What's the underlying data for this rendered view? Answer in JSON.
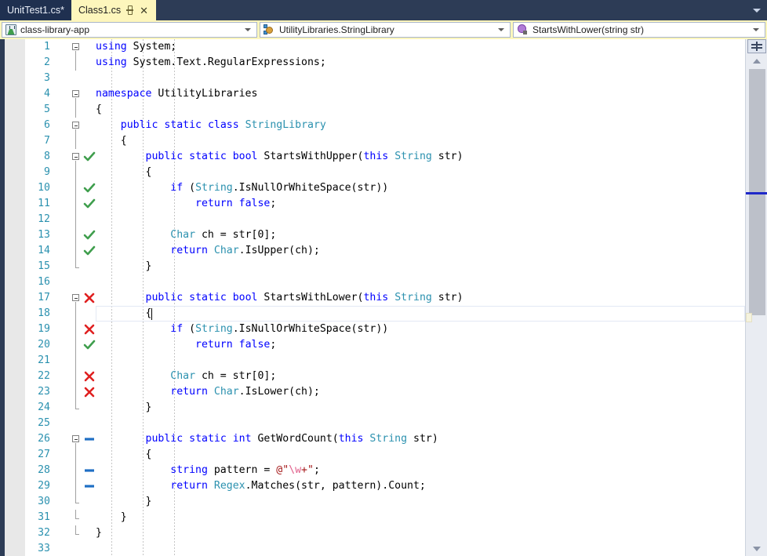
{
  "tabs": [
    {
      "name": "UnitTest1.cs*",
      "active": false,
      "dirty": true
    },
    {
      "name": "Class1.cs",
      "active": true,
      "dirty": false,
      "pin_icon": "pin-icon",
      "close_icon": "close-icon"
    }
  ],
  "tabstrip": {
    "overflow_icon": "chevron-down-icon"
  },
  "navbar": {
    "project": {
      "label": "class-library-app",
      "icon": "test-project-flask-icon",
      "arrow_icon": "chevron-down-icon"
    },
    "type": {
      "label": "UtilityLibraries.StringLibrary",
      "icon": "class-icon",
      "arrow_icon": "chevron-down-icon"
    },
    "member": {
      "label": "StartsWithLower(string str)",
      "icon": "method-icon",
      "arrow_icon": "chevron-down-icon"
    }
  },
  "editor": {
    "language": "csharp",
    "cursor_line": 18,
    "cursor_column": 10,
    "colors": {
      "keyword": "#0000ff",
      "type": "#2b91af",
      "string": "#a31515",
      "plain": "#000000",
      "line_number": "#2b91af",
      "covered": "#3f9e4d",
      "not_covered": "#e02020",
      "partially_covered": "#1f6fc4",
      "tab_active_bg": "#fdf6bc",
      "tab_inactive_bg": "#1f3050",
      "chrome_bg": "#2d3c56"
    },
    "glyph_legend": {
      "check": "code-coverage-covered-icon",
      "cross": "code-coverage-not-covered-icon",
      "dash": "code-coverage-not-run-icon"
    },
    "lines": [
      {
        "n": 1,
        "fold": "start",
        "cov": "none",
        "indent": 0,
        "tokens": [
          {
            "t": "using",
            "c": "kw"
          },
          {
            "t": " System;",
            "c": "pln"
          }
        ]
      },
      {
        "n": 2,
        "fold": "mid",
        "cov": "none",
        "indent": 0,
        "tokens": [
          {
            "t": "using",
            "c": "kw"
          },
          {
            "t": " System.Text.RegularExpressions;",
            "c": "pln"
          }
        ]
      },
      {
        "n": 3,
        "fold": "none",
        "cov": "none",
        "indent": 0,
        "tokens": []
      },
      {
        "n": 4,
        "fold": "start",
        "cov": "none",
        "indent": 0,
        "tokens": [
          {
            "t": "namespace",
            "c": "kw"
          },
          {
            "t": " UtilityLibraries",
            "c": "pln"
          }
        ]
      },
      {
        "n": 5,
        "fold": "mid",
        "cov": "none",
        "indent": 0,
        "tokens": [
          {
            "t": "{",
            "c": "pln"
          }
        ]
      },
      {
        "n": 6,
        "fold": "start",
        "cov": "none",
        "indent": 1,
        "tokens": [
          {
            "t": "    ",
            "c": "pln"
          },
          {
            "t": "public",
            "c": "kw"
          },
          {
            "t": " ",
            "c": "pln"
          },
          {
            "t": "static",
            "c": "kw"
          },
          {
            "t": " ",
            "c": "pln"
          },
          {
            "t": "class",
            "c": "kw"
          },
          {
            "t": " ",
            "c": "pln"
          },
          {
            "t": "StringLibrary",
            "c": "typ"
          }
        ]
      },
      {
        "n": 7,
        "fold": "mid",
        "cov": "none",
        "indent": 1,
        "tokens": [
          {
            "t": "    {",
            "c": "pln"
          }
        ]
      },
      {
        "n": 8,
        "fold": "start",
        "cov": "check",
        "indent": 2,
        "tokens": [
          {
            "t": "        ",
            "c": "pln"
          },
          {
            "t": "public",
            "c": "kw"
          },
          {
            "t": " ",
            "c": "pln"
          },
          {
            "t": "static",
            "c": "kw"
          },
          {
            "t": " ",
            "c": "pln"
          },
          {
            "t": "bool",
            "c": "kw"
          },
          {
            "t": " StartsWithUpper(",
            "c": "pln"
          },
          {
            "t": "this",
            "c": "kw"
          },
          {
            "t": " ",
            "c": "pln"
          },
          {
            "t": "String",
            "c": "typ"
          },
          {
            "t": " str)",
            "c": "pln"
          }
        ]
      },
      {
        "n": 9,
        "fold": "mid",
        "cov": "none",
        "indent": 2,
        "tokens": [
          {
            "t": "        {",
            "c": "pln"
          }
        ]
      },
      {
        "n": 10,
        "fold": "mid",
        "cov": "check",
        "indent": 3,
        "tokens": [
          {
            "t": "            ",
            "c": "pln"
          },
          {
            "t": "if",
            "c": "kw"
          },
          {
            "t": " (",
            "c": "pln"
          },
          {
            "t": "String",
            "c": "typ"
          },
          {
            "t": ".IsNullOrWhiteSpace(str))",
            "c": "pln"
          }
        ]
      },
      {
        "n": 11,
        "fold": "mid",
        "cov": "check",
        "indent": 4,
        "tokens": [
          {
            "t": "                ",
            "c": "pln"
          },
          {
            "t": "return",
            "c": "kw"
          },
          {
            "t": " ",
            "c": "pln"
          },
          {
            "t": "false",
            "c": "kw"
          },
          {
            "t": ";",
            "c": "pln"
          }
        ]
      },
      {
        "n": 12,
        "fold": "mid",
        "cov": "none",
        "indent": 3,
        "tokens": []
      },
      {
        "n": 13,
        "fold": "mid",
        "cov": "check",
        "indent": 3,
        "tokens": [
          {
            "t": "            ",
            "c": "pln"
          },
          {
            "t": "Char",
            "c": "typ"
          },
          {
            "t": " ch = str[",
            "c": "pln"
          },
          {
            "t": "0",
            "c": "pln"
          },
          {
            "t": "];",
            "c": "pln"
          }
        ]
      },
      {
        "n": 14,
        "fold": "mid",
        "cov": "check",
        "indent": 3,
        "tokens": [
          {
            "t": "            ",
            "c": "pln"
          },
          {
            "t": "return",
            "c": "kw"
          },
          {
            "t": " ",
            "c": "pln"
          },
          {
            "t": "Char",
            "c": "typ"
          },
          {
            "t": ".IsUpper(ch);",
            "c": "pln"
          }
        ]
      },
      {
        "n": 15,
        "fold": "end",
        "cov": "none",
        "indent": 2,
        "tokens": [
          {
            "t": "        }",
            "c": "pln"
          }
        ]
      },
      {
        "n": 16,
        "fold": "none",
        "cov": "none",
        "indent": 2,
        "tokens": []
      },
      {
        "n": 17,
        "fold": "start",
        "cov": "cross",
        "indent": 2,
        "tokens": [
          {
            "t": "        ",
            "c": "pln"
          },
          {
            "t": "public",
            "c": "kw"
          },
          {
            "t": " ",
            "c": "pln"
          },
          {
            "t": "static",
            "c": "kw"
          },
          {
            "t": " ",
            "c": "pln"
          },
          {
            "t": "bool",
            "c": "kw"
          },
          {
            "t": " StartsWithLower(",
            "c": "pln"
          },
          {
            "t": "this",
            "c": "kw"
          },
          {
            "t": " ",
            "c": "pln"
          },
          {
            "t": "String",
            "c": "typ"
          },
          {
            "t": " str)",
            "c": "pln"
          }
        ]
      },
      {
        "n": 18,
        "fold": "mid",
        "cov": "none",
        "indent": 2,
        "current": true,
        "tokens": [
          {
            "t": "        {",
            "c": "pln"
          }
        ]
      },
      {
        "n": 19,
        "fold": "mid",
        "cov": "cross",
        "indent": 3,
        "tokens": [
          {
            "t": "            ",
            "c": "pln"
          },
          {
            "t": "if",
            "c": "kw"
          },
          {
            "t": " (",
            "c": "pln"
          },
          {
            "t": "String",
            "c": "typ"
          },
          {
            "t": ".IsNullOrWhiteSpace(str))",
            "c": "pln"
          }
        ]
      },
      {
        "n": 20,
        "fold": "mid",
        "cov": "check",
        "indent": 4,
        "tokens": [
          {
            "t": "                ",
            "c": "pln"
          },
          {
            "t": "return",
            "c": "kw"
          },
          {
            "t": " ",
            "c": "pln"
          },
          {
            "t": "false",
            "c": "kw"
          },
          {
            "t": ";",
            "c": "pln"
          }
        ]
      },
      {
        "n": 21,
        "fold": "mid",
        "cov": "none",
        "indent": 3,
        "tokens": []
      },
      {
        "n": 22,
        "fold": "mid",
        "cov": "cross",
        "indent": 3,
        "tokens": [
          {
            "t": "            ",
            "c": "pln"
          },
          {
            "t": "Char",
            "c": "typ"
          },
          {
            "t": " ch = str[",
            "c": "pln"
          },
          {
            "t": "0",
            "c": "pln"
          },
          {
            "t": "];",
            "c": "pln"
          }
        ]
      },
      {
        "n": 23,
        "fold": "mid",
        "cov": "cross",
        "indent": 3,
        "tokens": [
          {
            "t": "            ",
            "c": "pln"
          },
          {
            "t": "return",
            "c": "kw"
          },
          {
            "t": " ",
            "c": "pln"
          },
          {
            "t": "Char",
            "c": "typ"
          },
          {
            "t": ".IsLower(ch);",
            "c": "pln"
          }
        ]
      },
      {
        "n": 24,
        "fold": "end",
        "cov": "none",
        "indent": 2,
        "tokens": [
          {
            "t": "        }",
            "c": "pln"
          }
        ]
      },
      {
        "n": 25,
        "fold": "none",
        "cov": "none",
        "indent": 2,
        "tokens": []
      },
      {
        "n": 26,
        "fold": "start",
        "cov": "dash",
        "indent": 2,
        "tokens": [
          {
            "t": "        ",
            "c": "pln"
          },
          {
            "t": "public",
            "c": "kw"
          },
          {
            "t": " ",
            "c": "pln"
          },
          {
            "t": "static",
            "c": "kw"
          },
          {
            "t": " ",
            "c": "pln"
          },
          {
            "t": "int",
            "c": "kw"
          },
          {
            "t": " GetWordCount(",
            "c": "pln"
          },
          {
            "t": "this",
            "c": "kw"
          },
          {
            "t": " ",
            "c": "pln"
          },
          {
            "t": "String",
            "c": "typ"
          },
          {
            "t": " str)",
            "c": "pln"
          }
        ]
      },
      {
        "n": 27,
        "fold": "mid",
        "cov": "none",
        "indent": 2,
        "tokens": [
          {
            "t": "        {",
            "c": "pln"
          }
        ]
      },
      {
        "n": 28,
        "fold": "mid",
        "cov": "dash",
        "indent": 3,
        "tokens": [
          {
            "t": "            ",
            "c": "pln"
          },
          {
            "t": "string",
            "c": "kw"
          },
          {
            "t": " pattern = ",
            "c": "pln"
          },
          {
            "t": "@\"",
            "c": "str"
          },
          {
            "t": "\\w",
            "c": "esc"
          },
          {
            "t": "+\"",
            "c": "str"
          },
          {
            "t": ";",
            "c": "pln"
          }
        ]
      },
      {
        "n": 29,
        "fold": "mid",
        "cov": "dash",
        "indent": 3,
        "tokens": [
          {
            "t": "            ",
            "c": "pln"
          },
          {
            "t": "return",
            "c": "kw"
          },
          {
            "t": " ",
            "c": "pln"
          },
          {
            "t": "Regex",
            "c": "typ"
          },
          {
            "t": ".Matches(str, pattern).Count;",
            "c": "pln"
          }
        ]
      },
      {
        "n": 30,
        "fold": "end",
        "cov": "none",
        "indent": 2,
        "tokens": [
          {
            "t": "        }",
            "c": "pln"
          }
        ]
      },
      {
        "n": 31,
        "fold": "end",
        "cov": "none",
        "indent": 1,
        "tokens": [
          {
            "t": "    }",
            "c": "pln"
          }
        ]
      },
      {
        "n": 32,
        "fold": "end",
        "cov": "none",
        "indent": 0,
        "tokens": [
          {
            "t": "}",
            "c": "pln"
          }
        ]
      },
      {
        "n": 33,
        "fold": "none",
        "cov": "none",
        "indent": 0,
        "tokens": []
      }
    ]
  },
  "scrollbar": {
    "split_button_icon": "split-editor-icon",
    "up_arrow_icon": "scroll-up-icon",
    "down_arrow_icon": "scroll-down-icon",
    "thumb": "scroll-thumb"
  }
}
